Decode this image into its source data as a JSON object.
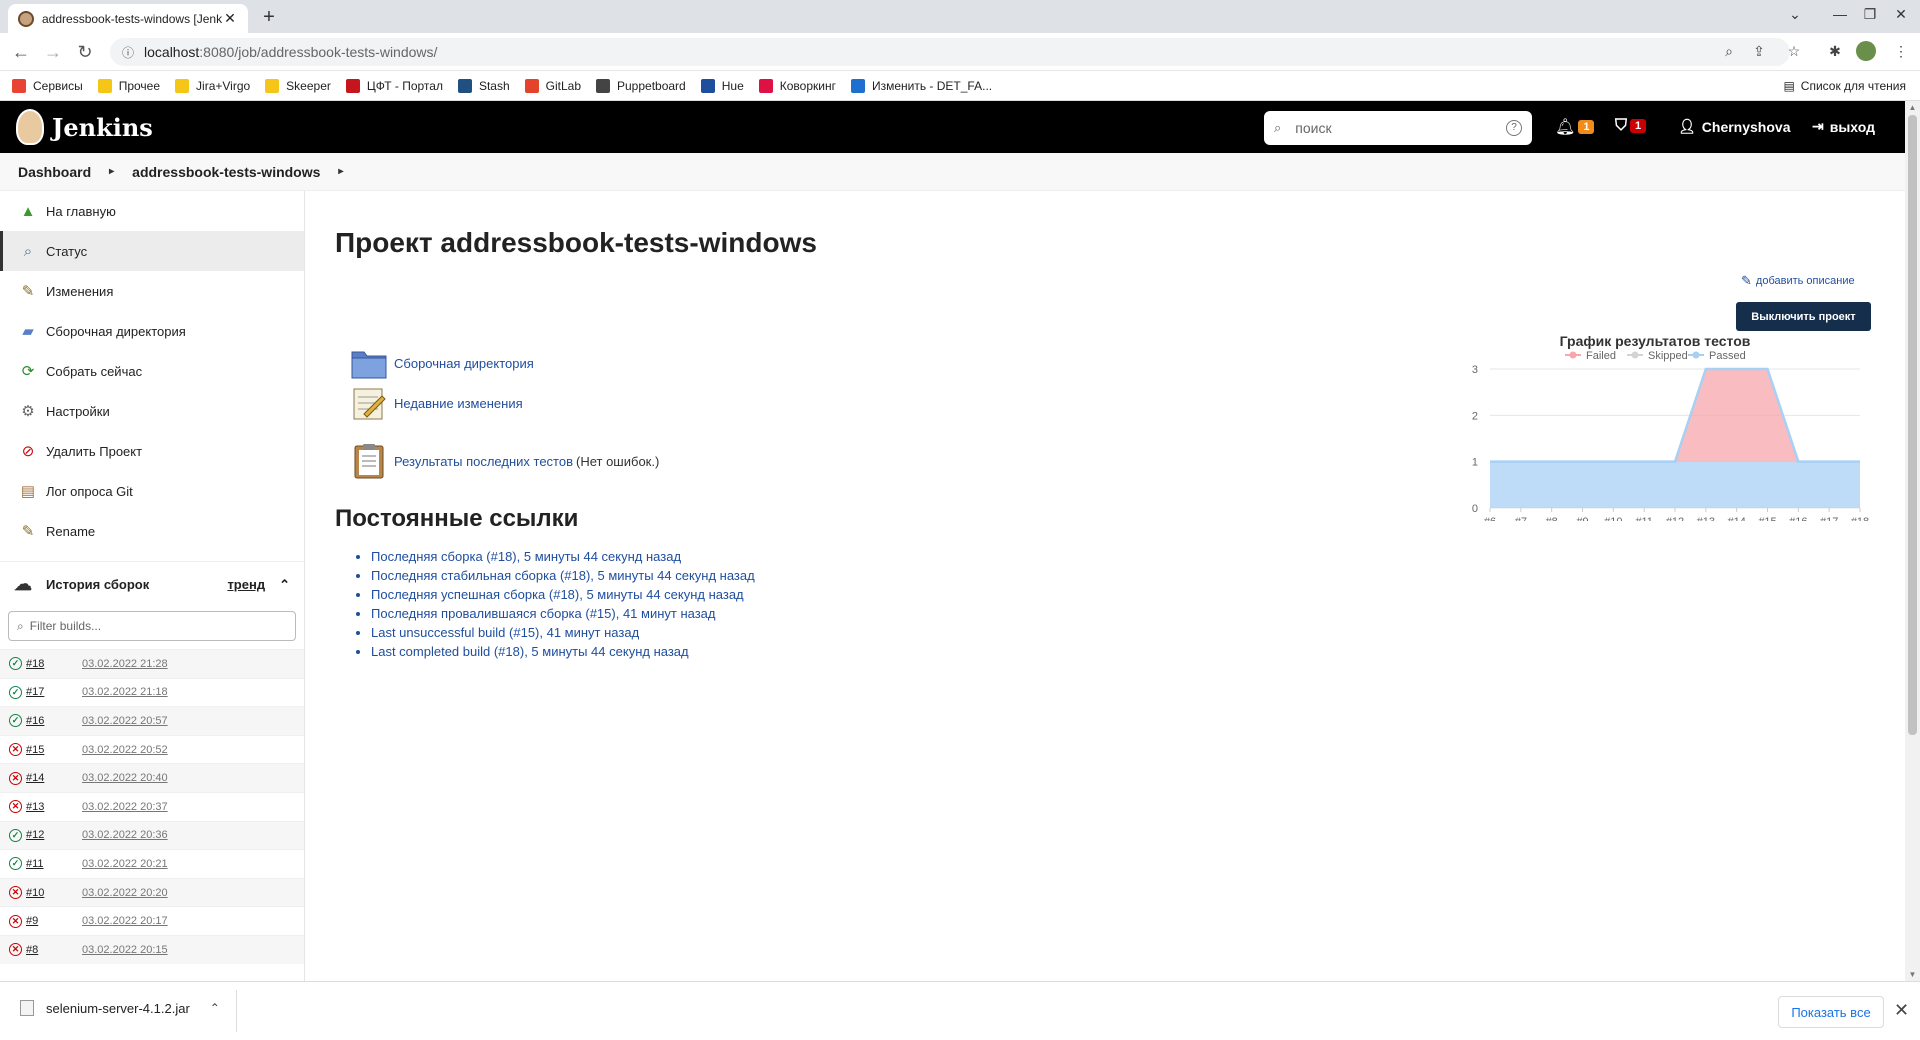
{
  "browser": {
    "tab_title": "addressbook-tests-windows [Jenkins]",
    "url_host": "localhost",
    "url_path": ":8080/job/addressbook-tests-windows/",
    "new_tab": "+",
    "min": "⌄",
    "bookmarks": [
      {
        "label": "Сервисы",
        "color": "#e84335"
      },
      {
        "label": "Прочее",
        "color": "#f5c518"
      },
      {
        "label": "Jira+Virgo",
        "color": "#f5c518"
      },
      {
        "label": "Skeeper",
        "color": "#f5c518"
      },
      {
        "label": "ЦФТ - Портал",
        "color": "#c4161c"
      },
      {
        "label": "Stash",
        "color": "#205081"
      },
      {
        "label": "GitLab",
        "color": "#e2432a"
      },
      {
        "label": "Puppetboard",
        "color": "#444444"
      },
      {
        "label": "Hue",
        "color": "#1f4e9e"
      },
      {
        "label": "Коворкинг",
        "color": "#d14"
      },
      {
        "label": "Изменить - DET_FA...",
        "color": "#1f6fd0"
      }
    ],
    "reading_list": "Список для чтения"
  },
  "jenkins": {
    "brand": "Jenkins",
    "search_placeholder": "поиск",
    "notifications_count": "1",
    "security_count": "1",
    "user": "Chernyshova",
    "logout": "выход",
    "colors": {
      "notif": "#f28c19",
      "security": "#cc0003",
      "link": "#1f4e9e",
      "button": "#142e4c"
    }
  },
  "breadcrumbs": [
    "Dashboard",
    "addressbook-tests-windows"
  ],
  "sidebar": {
    "tasks": [
      {
        "label": "На главную",
        "icon": "up-arrow-icon"
      },
      {
        "label": "Статус",
        "icon": "magnifier-icon"
      },
      {
        "label": "Изменения",
        "icon": "notepad-icon"
      },
      {
        "label": "Сборочная директория",
        "icon": "folder-icon"
      },
      {
        "label": "Собрать сейчас",
        "icon": "build-now-icon"
      },
      {
        "label": "Настройки",
        "icon": "gear-icon"
      },
      {
        "label": "Удалить Проект",
        "icon": "no-entry-icon"
      },
      {
        "label": "Лог опроса Git",
        "icon": "clipboard-icon"
      },
      {
        "label": "Rename",
        "icon": "notepad-icon"
      }
    ],
    "build_history": {
      "title": "История сборок",
      "trend": "тренд",
      "filter_placeholder": "Filter builds...",
      "builds": [
        {
          "num": "#18",
          "date": "03.02.2022 21:28",
          "status": "ok"
        },
        {
          "num": "#17",
          "date": "03.02.2022 21:18",
          "status": "ok"
        },
        {
          "num": "#16",
          "date": "03.02.2022 20:57",
          "status": "ok"
        },
        {
          "num": "#15",
          "date": "03.02.2022 20:52",
          "status": "fail"
        },
        {
          "num": "#14",
          "date": "03.02.2022 20:40",
          "status": "fail"
        },
        {
          "num": "#13",
          "date": "03.02.2022 20:37",
          "status": "fail"
        },
        {
          "num": "#12",
          "date": "03.02.2022 20:36",
          "status": "ok"
        },
        {
          "num": "#11",
          "date": "03.02.2022 20:21",
          "status": "ok"
        },
        {
          "num": "#10",
          "date": "03.02.2022 20:20",
          "status": "fail"
        },
        {
          "num": "#9",
          "date": "03.02.2022 20:17",
          "status": "fail"
        },
        {
          "num": "#8",
          "date": "03.02.2022 20:15",
          "status": "fail"
        }
      ]
    }
  },
  "main": {
    "title": "Проект addressbook-tests-windows",
    "add_description": "добавить описание",
    "disable_project": "Выключить проект",
    "links": {
      "workspace": "Сборочная директория",
      "recent_changes": "Недавние изменения",
      "test_results": "Результаты последних тестов",
      "test_results_extra": "(Нет ошибок.)"
    },
    "permalinks_title": "Постоянные ссылки",
    "permalinks": [
      "Последняя сборка (#18), 5 минуты 44 секунд назад",
      "Последняя стабильная сборка (#18), 5 минуты 44 секунд назад",
      "Последняя успешная сборка (#18), 5 минуты 44 секунд назад",
      "Последняя провалившаяся сборка (#15), 41 минут назад",
      "Last unsuccessful build (#15), 41 минут назад",
      "Last completed build (#18), 5 минуты 44 секунд назад"
    ]
  },
  "chart_data": {
    "type": "area",
    "title": "График результатов тестов",
    "categories": [
      "#6",
      "#7",
      "#8",
      "#9",
      "#10",
      "#11",
      "#12",
      "#13",
      "#14",
      "#15",
      "#16",
      "#17",
      "#18"
    ],
    "series": [
      {
        "name": "Failed",
        "color": "#f7a6ab",
        "values": [
          0,
          0,
          0,
          0,
          0,
          0,
          0,
          2,
          2,
          2,
          0,
          0,
          0
        ]
      },
      {
        "name": "Skipped",
        "color": "#d3d3d3",
        "values": [
          0,
          0,
          0,
          0,
          0,
          0,
          0,
          0,
          0,
          0,
          0,
          0,
          0
        ]
      },
      {
        "name": "Passed",
        "color": "#a8d0f5",
        "values": [
          1,
          1,
          1,
          1,
          1,
          1,
          1,
          1,
          1,
          1,
          1,
          1,
          1
        ]
      }
    ],
    "ylim": [
      0,
      3
    ],
    "yticks": [
      0,
      1,
      2,
      3
    ],
    "legend": "top",
    "grid": true
  },
  "downloads": {
    "file": "selenium-server-4.1.2.jar",
    "show_all": "Показать все"
  }
}
